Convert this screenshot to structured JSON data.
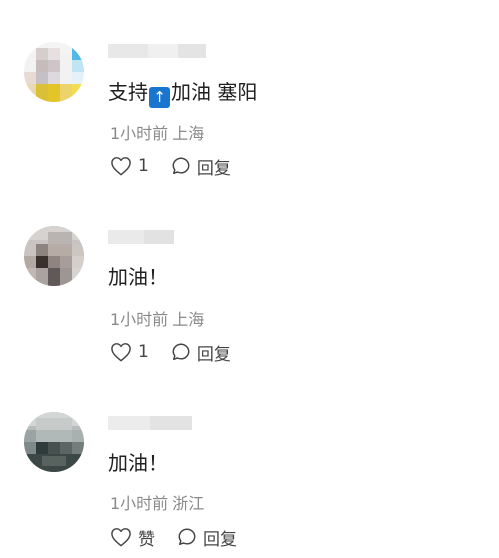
{
  "comments": [
    {
      "username": "███████",
      "content_pre": "支持",
      "content_emoji": "↑",
      "content_post": "加油 塞阳",
      "time": "1小时前",
      "location": "上海",
      "like_label": "1",
      "reply_label": "回复"
    },
    {
      "username": "██████",
      "content": "加油！",
      "time": "1小时前",
      "location": "上海",
      "like_label": "1",
      "reply_label": "回复"
    },
    {
      "username": "███████",
      "content": "加油！",
      "time": "1小时前",
      "location": "浙江",
      "like_label": "赞",
      "reply_label": "回复"
    }
  ],
  "colors": {
    "text": "#202020",
    "meta": "#8a8a8a",
    "emoji_bg": "#1a75d1"
  }
}
